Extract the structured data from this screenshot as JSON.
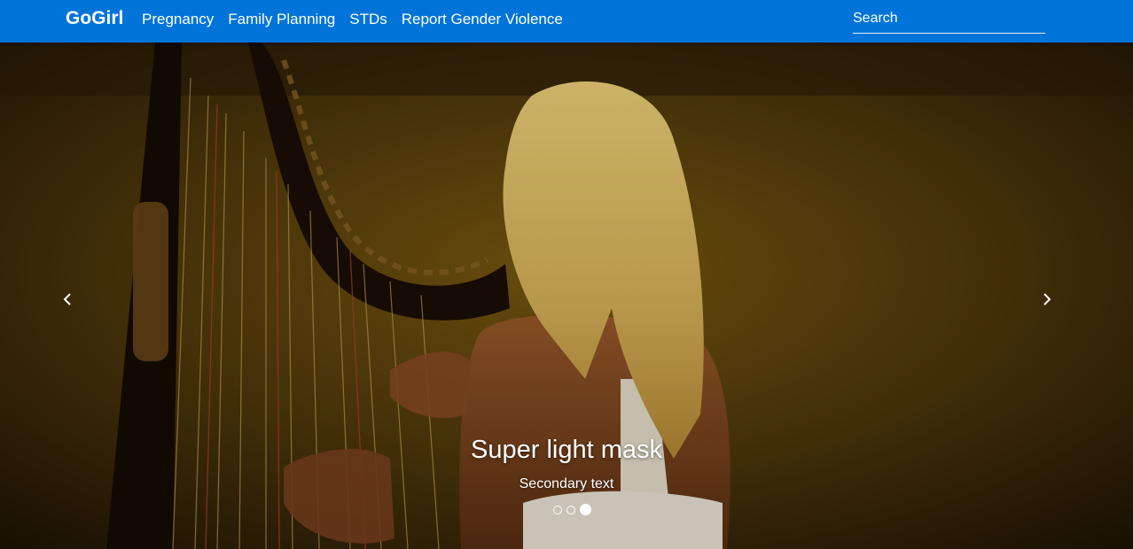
{
  "navbar": {
    "brand": "GoGirl",
    "links": [
      "Pregnancy",
      "Family Planning",
      "STDs",
      "Report Gender Violence"
    ],
    "search_placeholder": "Search",
    "color": "#0074d9"
  },
  "carousel": {
    "caption_title": "Super light mask",
    "caption_text": "Secondary text",
    "slide_count": 3,
    "active_slide": 3,
    "prev_icon": "chevron-left-icon",
    "next_icon": "chevron-right-icon"
  }
}
